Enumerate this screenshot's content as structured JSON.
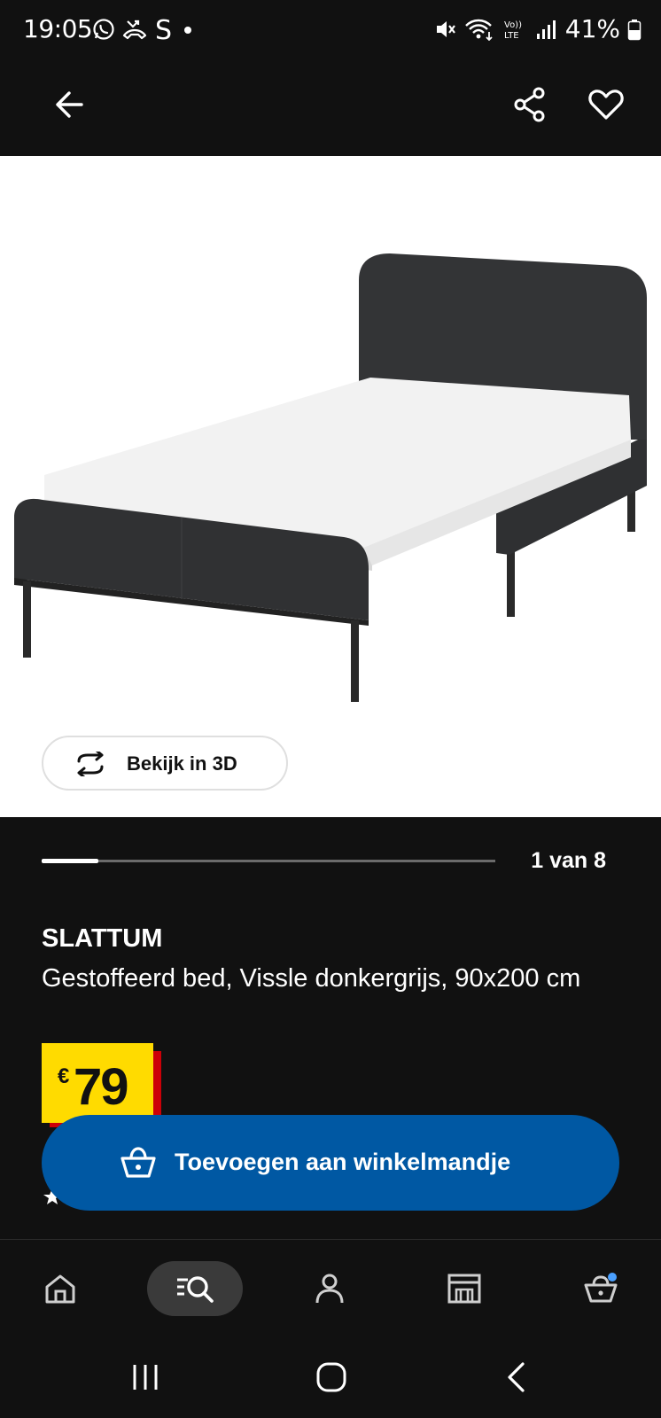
{
  "status_bar": {
    "time": "19:05",
    "battery": "41%",
    "icons": [
      "whatsapp-icon",
      "missed-call-icon",
      "s-app-icon",
      "dot-icon",
      "mute-icon",
      "wifi-icon",
      "volte-icon",
      "signal-icon",
      "battery-icon"
    ],
    "volte_label": "Vo)) LTE"
  },
  "appbar": {
    "icons": [
      "back-arrow-icon",
      "share-icon",
      "heart-icon"
    ]
  },
  "media": {
    "view3d_label": "Bekijk in 3D",
    "pager_text": "1 van 8",
    "pager_progress": 0.125
  },
  "product": {
    "name": "SLATTUM",
    "description": "Gestoffeerd bed, Vissle donkergrijs, 90x200 cm",
    "price_currency": "€",
    "price_value": "79"
  },
  "cart": {
    "label": "Toevoegen aan winkelmandje"
  },
  "bottom_nav": {
    "items": [
      "home-icon",
      "search-icon",
      "profile-icon",
      "store-icon",
      "cart-icon"
    ],
    "active": "search-icon"
  },
  "system_nav": {
    "items": [
      "recents-icon",
      "home-circle-icon",
      "back-chevron-icon"
    ]
  },
  "colors": {
    "background": "#111111",
    "accent_blue": "#0058a3",
    "price_yellow": "#ffdb00",
    "price_red": "#cc0008",
    "badge_blue": "#4aa0ff"
  }
}
